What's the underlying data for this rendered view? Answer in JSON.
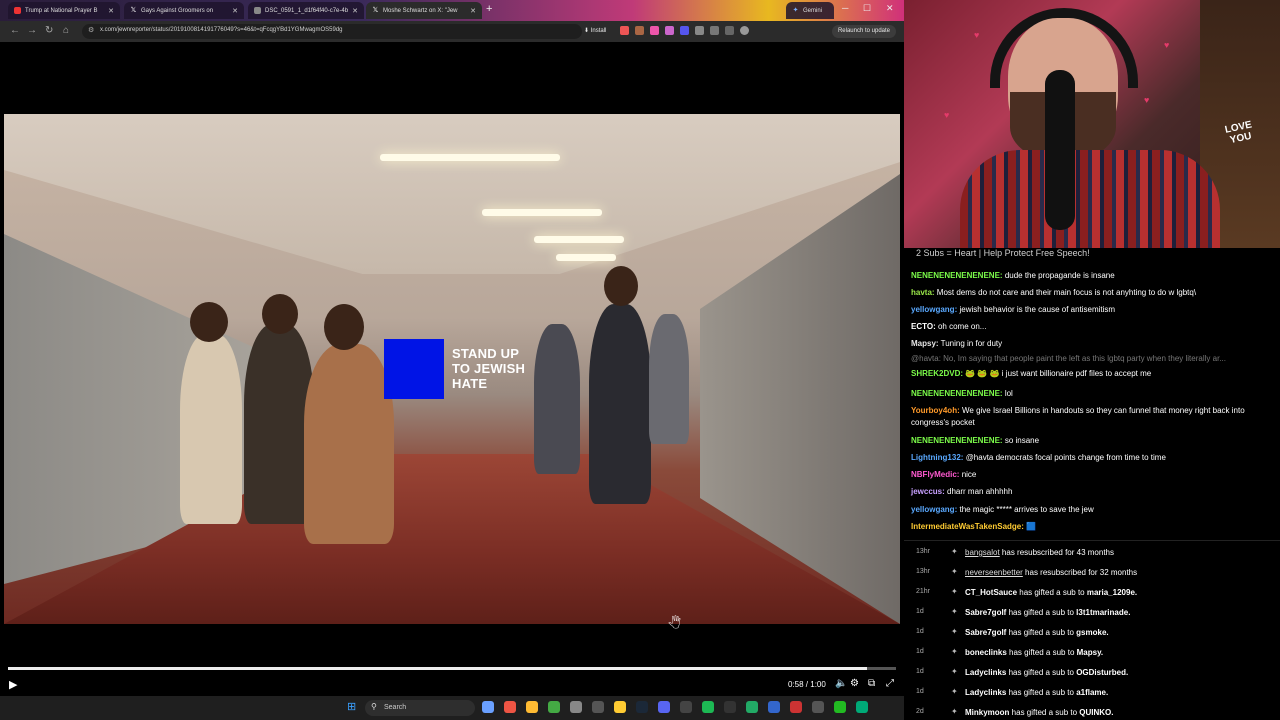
{
  "browser": {
    "tabs": [
      {
        "label": "Trump at National Prayer B",
        "fav": "red"
      },
      {
        "label": "Gays Against Groomers on",
        "fav": "x"
      },
      {
        "label": "DSC_0591_1_d1f64f40-c7e-4b",
        "fav": "gray"
      },
      {
        "label": "Moshe Schwartz on X: \"Jew",
        "fav": "x",
        "active": true
      },
      {
        "label": "Gemini",
        "fav": "gem"
      }
    ],
    "new_tab": "+",
    "address": "x.com/jewnreporter/status/2019100814191776049?s=46&t=qFcqgYBd1YGMwagmOS59dg",
    "install_label": "Install",
    "relaunch_label": "Relaunch to update"
  },
  "video": {
    "overlay_text": [
      "STAND UP",
      "TO JEWISH",
      "HATE"
    ],
    "timecode": "0:58 / 1:00",
    "progress": 0.967
  },
  "taskbar": {
    "search_label": "Search"
  },
  "webcam": {
    "sign_text": [
      "LOVE",
      "YOU"
    ]
  },
  "chat": {
    "title": "2 Subs = Heart | Help Protect Free Speech!",
    "messages": [
      {
        "user": "NENENENENENENENE:",
        "color": "#7cfc4a",
        "text": "dude the propagande is insane"
      },
      {
        "user": "havta:",
        "color": "#9be84a",
        "text": "Most dems do not care and their main focus is not anyhting to do w lgbtq\\"
      },
      {
        "user": "yellowgang:",
        "color": "#5aa9ff",
        "text": "jewish behavior is the cause of antisemitism"
      },
      {
        "user": "ECTO:",
        "color": "#ffffff",
        "text": "oh come on..."
      },
      {
        "user": "Mapsy:",
        "color": "#e6e6e6",
        "text": "Tuning in for duty"
      },
      {
        "user": "",
        "color": "#777",
        "text": "@havta: No, Im saying that people paint the left as this lgbtq party when they literally ar...",
        "dim": true
      },
      {
        "user": "SHREK2DVD:",
        "color": "#7cfc4a",
        "text": "🐸 🐸 🐸 i just want billionaire pdf files to accept me"
      },
      {
        "user": "NENENENENENENENE:",
        "color": "#7cfc4a",
        "text": "lol"
      },
      {
        "user": "Yourboy4oh:",
        "color": "#ff9a2a",
        "text": "We give Israel Billions in handouts so they can funnel that money right back into congress's pocket"
      },
      {
        "user": "NENENENENENENENE:",
        "color": "#7cfc4a",
        "text": "so insane"
      },
      {
        "user": "Lightning132:",
        "color": "#5aa9ff",
        "text": "@havta democrats focal points change from time to time"
      },
      {
        "user": "NBFlyMedic:",
        "color": "#ff5ad0",
        "text": "nice"
      },
      {
        "user": "jewccus:",
        "color": "#c8a0ff",
        "text": "dharr man ahhhhh"
      },
      {
        "user": "yellowgang:",
        "color": "#5aa9ff",
        "text": "the magic ***** arrives to save the jew"
      },
      {
        "user": "IntermediateWasTakenSadge:",
        "color": "#ffcc33",
        "text": "🟦"
      }
    ]
  },
  "events": [
    {
      "time": "13hr",
      "user": "bangsalot",
      "text": " has resubscribed for 43 months"
    },
    {
      "time": "13hr",
      "user": "neverseenbetter",
      "text": " has resubscribed for 32 months"
    },
    {
      "time": "21hr",
      "user": "CT_HotSauce",
      "text": " has gifted a sub to ",
      "target": "maria_1209e."
    },
    {
      "time": "1d",
      "user": "Sabre7golf",
      "text": " has gifted a sub to ",
      "target": "l3t1tmarinade."
    },
    {
      "time": "1d",
      "user": "Sabre7golf",
      "text": " has gifted a sub to ",
      "target": "gsmoke."
    },
    {
      "time": "1d",
      "user": "boneclinks",
      "text": " has gifted a sub to ",
      "target": "Mapsy."
    },
    {
      "time": "1d",
      "user": "Ladyclinks",
      "text": " has gifted a sub to ",
      "target": "OGDisturbed."
    },
    {
      "time": "1d",
      "user": "Ladyclinks",
      "text": " has gifted a sub to ",
      "target": "a1flame."
    },
    {
      "time": "2d",
      "user": "Minkymoon",
      "text": " has gifted a sub to ",
      "target": "QUINKO."
    }
  ],
  "colors": {
    "overlay_square": "#0014e6",
    "chrome_bg": "#2b2b2b"
  }
}
